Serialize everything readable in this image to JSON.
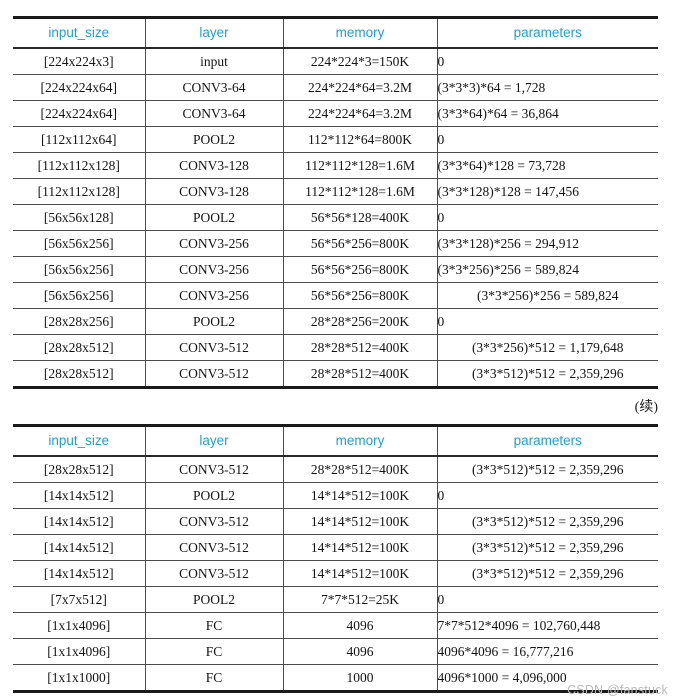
{
  "document": {
    "continuation_marker": "(续)",
    "watermark": "CSDN @fanstuck",
    "header_color": "#1e9fd8",
    "text_color": "#141414",
    "rule_color": "#1a1a1a"
  },
  "tables": [
    {
      "name": "vgg-memory-parameters-table-part1",
      "columns": [
        "input_size",
        "layer",
        "memory",
        "parameters"
      ],
      "rows": [
        [
          "[224x224x3]",
          "input",
          "224*224*3=150K",
          "0"
        ],
        [
          "[224x224x64]",
          "CONV3-64",
          "224*224*64=3.2M",
          "(3*3*3)*64 = 1,728"
        ],
        [
          "[224x224x64]",
          "CONV3-64",
          "224*224*64=3.2M",
          "(3*3*64)*64 = 36,864"
        ],
        [
          "[112x112x64]",
          "POOL2",
          "112*112*64=800K",
          "0"
        ],
        [
          "[112x112x128]",
          "CONV3-128",
          "112*112*128=1.6M",
          "(3*3*64)*128 = 73,728"
        ],
        [
          "[112x112x128]",
          "CONV3-128",
          "112*112*128=1.6M",
          "(3*3*128)*128 = 147,456"
        ],
        [
          "[56x56x128]",
          "POOL2",
          "56*56*128=400K",
          "0"
        ],
        [
          "[56x56x256]",
          "CONV3-256",
          "56*56*256=800K",
          "(3*3*128)*256 = 294,912"
        ],
        [
          "[56x56x256]",
          "CONV3-256",
          "56*56*256=800K",
          "(3*3*256)*256 = 589,824"
        ],
        [
          "[56x56x256]",
          "CONV3-256",
          "56*56*256=800K",
          "(3*3*256)*256 = 589,824"
        ],
        [
          "[28x28x256]",
          "POOL2",
          "28*28*256=200K",
          "0"
        ],
        [
          "[28x28x512]",
          "CONV3-512",
          "28*28*512=400K",
          "(3*3*256)*512 = 1,179,648"
        ],
        [
          "[28x28x512]",
          "CONV3-512",
          "28*28*512=400K",
          "(3*3*512)*512 = 2,359,296"
        ]
      ],
      "param_centered_rows": [
        9,
        11,
        12
      ]
    },
    {
      "name": "vgg-memory-parameters-table-part2",
      "columns": [
        "input_size",
        "layer",
        "memory",
        "parameters"
      ],
      "rows": [
        [
          "[28x28x512]",
          "CONV3-512",
          "28*28*512=400K",
          "(3*3*512)*512 = 2,359,296"
        ],
        [
          "[14x14x512]",
          "POOL2",
          "14*14*512=100K",
          "0"
        ],
        [
          "[14x14x512]",
          "CONV3-512",
          "14*14*512=100K",
          "(3*3*512)*512 = 2,359,296"
        ],
        [
          "[14x14x512]",
          "CONV3-512",
          "14*14*512=100K",
          "(3*3*512)*512 = 2,359,296"
        ],
        [
          "[14x14x512]",
          "CONV3-512",
          "14*14*512=100K",
          "(3*3*512)*512 = 2,359,296"
        ],
        [
          "[7x7x512]",
          "POOL2",
          "7*7*512=25K",
          "0"
        ],
        [
          "[1x1x4096]",
          "FC",
          "4096",
          "7*7*512*4096 = 102,760,448"
        ],
        [
          "[1x1x4096]",
          "FC",
          "4096",
          "4096*4096 = 16,777,216"
        ],
        [
          "[1x1x1000]",
          "FC",
          "1000",
          "4096*1000 = 4,096,000"
        ]
      ],
      "param_centered_rows": [
        0,
        2,
        3,
        4
      ]
    }
  ]
}
